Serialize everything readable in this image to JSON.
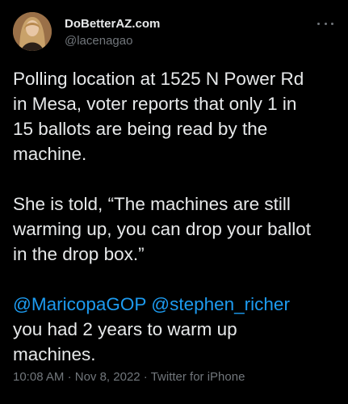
{
  "author": {
    "display_name": "DoBetterAZ.com",
    "handle": "@lacenagao",
    "avatar_icon": "profile-photo"
  },
  "more_icon": "ellipsis-icon",
  "tweet": {
    "p1_lines": [
      "Polling location at 1525 N Power Rd",
      "in Mesa, voter reports that only 1 in",
      "15 ballots are being read by the",
      "machine."
    ],
    "p2_lines": [
      "She is told, “The machines are still",
      "warming up, you can drop your ballot",
      "in the drop box.”"
    ],
    "mention1": "@MaricopaGOP",
    "mention2": "@stephen_richer",
    "p3_lines": [
      "you had 2 years to warm up",
      "machines."
    ]
  },
  "meta": {
    "time": "10:08 AM",
    "date": "Nov 8, 2022",
    "source": "Twitter for iPhone",
    "separator": "·"
  },
  "colors": {
    "background": "#000000",
    "text": "#e7e9ea",
    "secondary": "#71767b",
    "link": "#1d9bf0"
  }
}
